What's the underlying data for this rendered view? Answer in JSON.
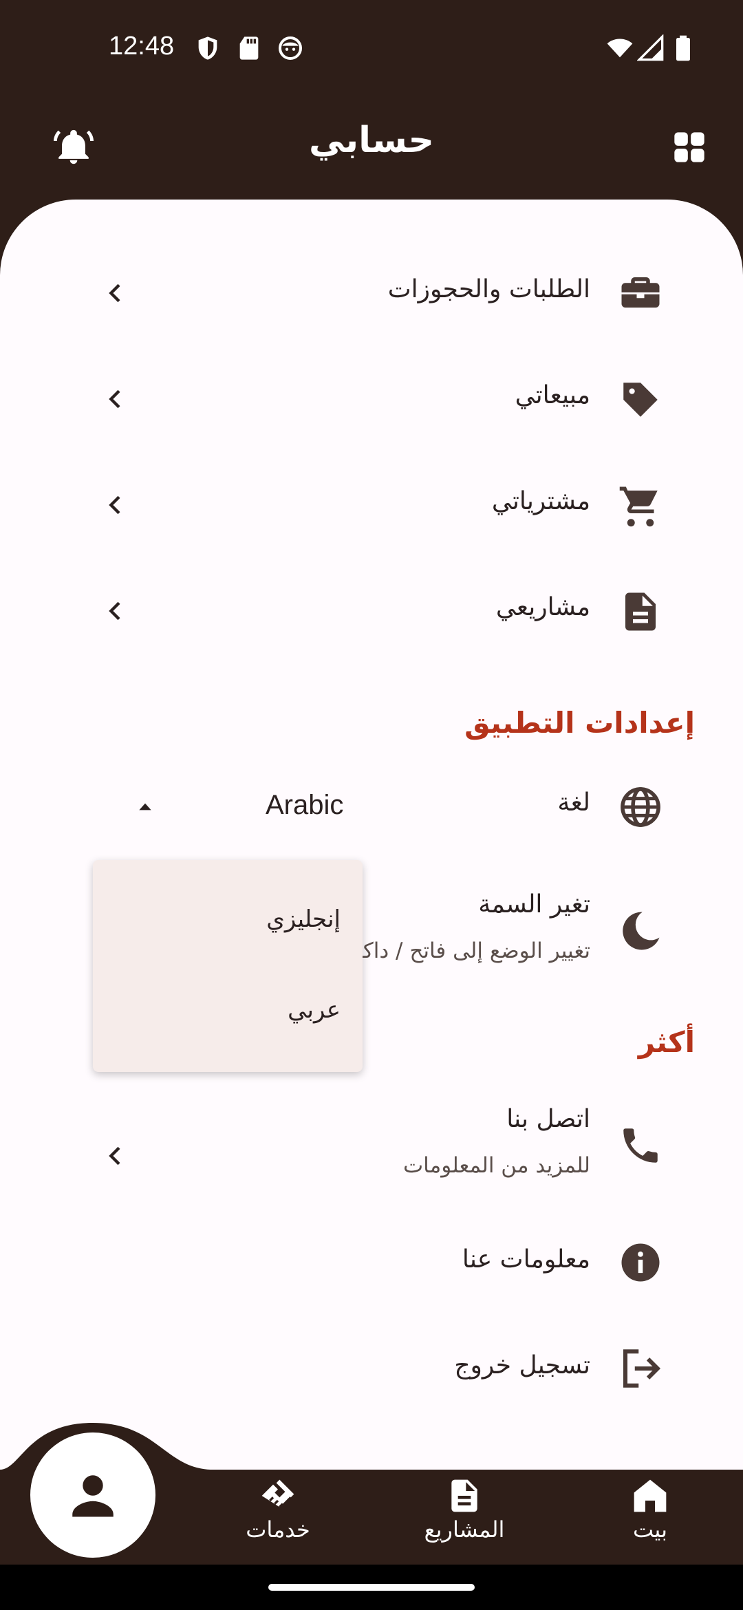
{
  "status_bar": {
    "time": "12:48"
  },
  "app_bar": {
    "title": "حسابي"
  },
  "account_items": [
    {
      "label": "الطلبات والحجوزات",
      "icon": "briefcase-icon"
    },
    {
      "label": "مبيعاتي",
      "icon": "tag-icon"
    },
    {
      "label": "مشترياتي",
      "icon": "cart-icon"
    },
    {
      "label": "مشاريعي",
      "icon": "document-icon"
    }
  ],
  "app_settings": {
    "title": "إعدادات التطبيق",
    "language": {
      "label": "لغة",
      "value": "Arabic",
      "icon": "globe-icon"
    },
    "theme": {
      "label": "تغير السمة",
      "subtitle": "تغيير الوضع إلى فاتح / داكن",
      "icon": "moon-icon"
    }
  },
  "language_dropdown": {
    "options": [
      "إنجليزي",
      "عربي"
    ]
  },
  "more": {
    "title": "أكثر",
    "contact": {
      "label": "اتصل بنا",
      "subtitle": "للمزيد من المعلومات",
      "icon": "phone-icon"
    },
    "about": {
      "label": "معلومات عنا",
      "icon": "info-icon"
    },
    "logout": {
      "label": "تسجيل خروج",
      "icon": "logout-icon"
    }
  },
  "bottom_nav": {
    "items": [
      {
        "label": "خدمات",
        "icon": "handshake-icon"
      },
      {
        "label": "المشاريع",
        "icon": "document-icon"
      },
      {
        "label": "بيت",
        "icon": "home-icon"
      }
    ],
    "profile_icon": "person-icon"
  },
  "colors": {
    "primary_dark": "#2E1E18",
    "accent": "#B5331A",
    "icon": "#4A3A36",
    "surface": "#FFFBFE",
    "menu": "#F6ECEA"
  }
}
